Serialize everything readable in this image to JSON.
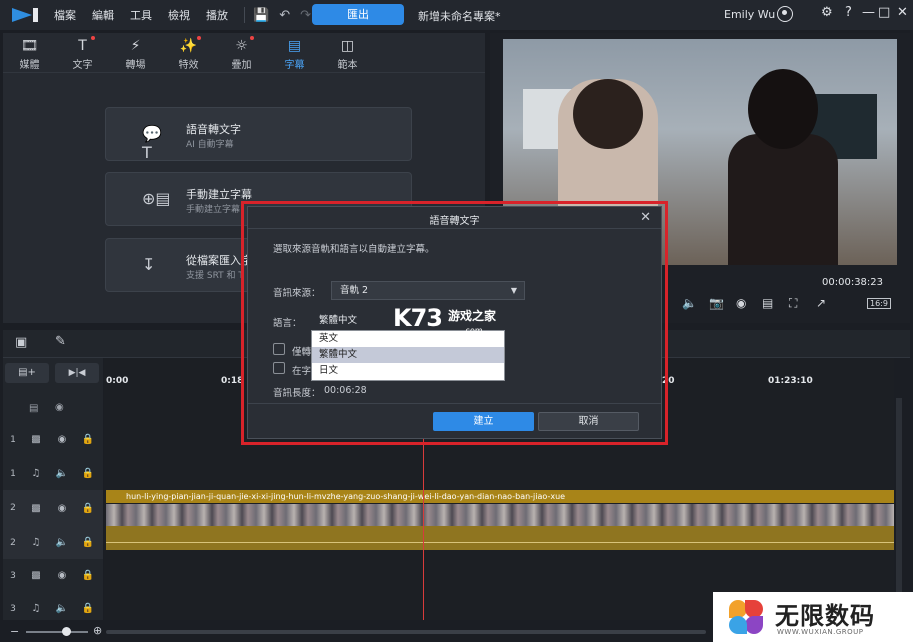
{
  "topbar": {
    "menu": [
      "檔案",
      "編輯",
      "工具",
      "檢視",
      "播放"
    ],
    "export_label": "匯出",
    "project_name": "新增未命名專案*",
    "user_name": "Emily Wu"
  },
  "tabs": [
    {
      "label": "媒體",
      "icon": "media-icon"
    },
    {
      "label": "文字",
      "icon": "text-icon"
    },
    {
      "label": "轉場",
      "icon": "transition-icon"
    },
    {
      "label": "特效",
      "icon": "effects-icon"
    },
    {
      "label": "疊加",
      "icon": "overlay-icon"
    },
    {
      "label": "字幕",
      "icon": "subtitle-icon"
    },
    {
      "label": "範本",
      "icon": "template-icon"
    }
  ],
  "cards": [
    {
      "title": "語音轉文字",
      "sub": "AI 自動字幕"
    },
    {
      "title": "手動建立字幕",
      "sub": "手動建立字幕"
    },
    {
      "title": "從檔案匯入字",
      "sub": "支援 SRT 和 T"
    }
  ],
  "preview": {
    "timecode": "00:00:38:23",
    "ratio": "16:9"
  },
  "timeline": {
    "ticks": [
      "0:00",
      "0:18",
      "20",
      "01:23:10"
    ],
    "tracks": [
      {
        "num": "1",
        "type": "video"
      },
      {
        "num": "1",
        "type": "audio"
      },
      {
        "num": "2",
        "type": "video"
      },
      {
        "num": "2",
        "type": "audio"
      },
      {
        "num": "3",
        "type": "video"
      },
      {
        "num": "3",
        "type": "audio"
      }
    ],
    "clip_name": "hun-li-ying-pian-jian-ji-quan-jie-xi-xi-jing-hun-li-mvzhe-yang-zuo-shang-ji-wei-li-dao-yan-dian-nao-ban-jiao-xue"
  },
  "dialog": {
    "title": "語音轉文字",
    "description": "選取來源音軌和語言以自動建立字幕。",
    "source_label": "音訊來源：",
    "source_value": "音軌 2",
    "language_label": "語言：",
    "language_value": "繁體中文",
    "language_options": [
      "英文",
      "繁體中文",
      "日文"
    ],
    "checkbox1_label": "僅轉",
    "checkbox2_label": "在字",
    "duration_label": "音訊長度：",
    "duration_value": "00:06:28",
    "create_label": "建立",
    "cancel_label": "取消"
  },
  "watermarks": {
    "k73_logo": "K73",
    "k73_text": "游戏之家",
    "k73_domain": ".com",
    "brand_text": "无限数码",
    "brand_url": "WWW.WUXIAN.GROUP"
  },
  "colors": {
    "accent": "#2e8ae6",
    "clip": "#a88418",
    "highlight": "#d8232a"
  }
}
